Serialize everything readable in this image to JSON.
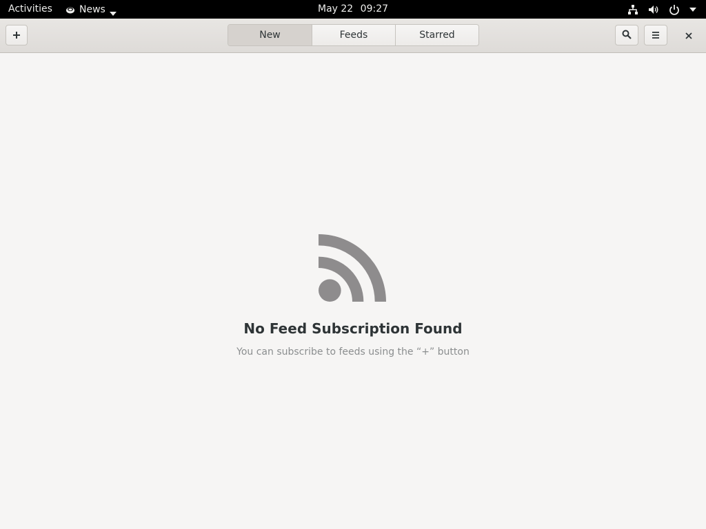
{
  "topbar": {
    "activities_label": "Activities",
    "app_name": "News",
    "date": "May 22",
    "time": "09:27"
  },
  "headerbar": {
    "tabs": [
      {
        "label": "New",
        "active": true
      },
      {
        "label": "Feeds",
        "active": false
      },
      {
        "label": "Starred",
        "active": false
      }
    ],
    "add_icon": "plus-icon",
    "search_icon": "search-icon",
    "menu_icon": "hamburger-menu-icon",
    "close_icon": "close-icon"
  },
  "empty_state": {
    "icon": "rss-feed-icon",
    "title": "No Feed Subscription Found",
    "subtitle": "You can subscribe to feeds using the “+” button"
  },
  "colors": {
    "topbar_bg": "#000000",
    "window_bg": "#f6f5f4",
    "icon_gray": "#8e8c8d",
    "title_text": "#2e3436",
    "subtitle_text": "#8b8e8f"
  }
}
